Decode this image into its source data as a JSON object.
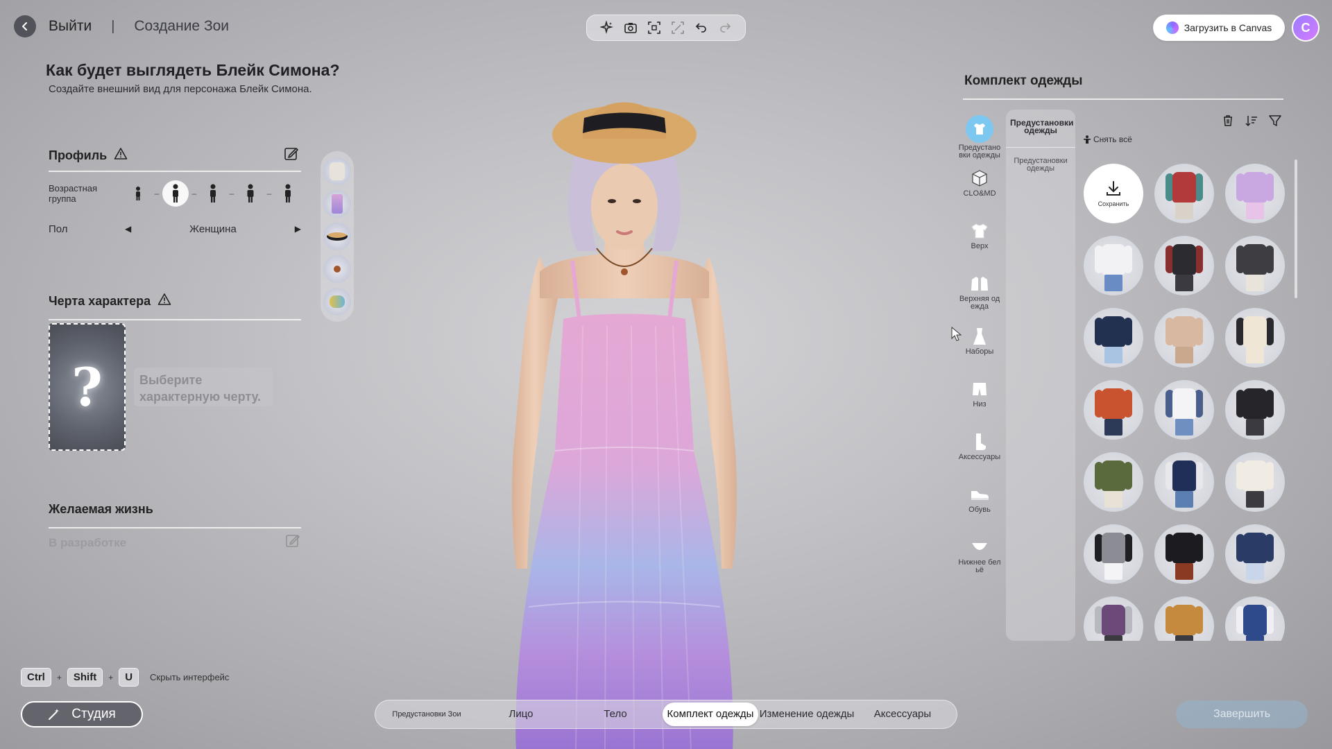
{
  "top": {
    "exit_label": "Выйти",
    "separator": "|",
    "breadcrumb": "Создание Зои",
    "tools": [
      "sparkle-icon",
      "camera-icon",
      "focus-frame-icon",
      "crop-frame-icon",
      "undo-icon",
      "redo-icon"
    ],
    "canvas_button": "Загрузить в Canvas",
    "avatar_letter": "C"
  },
  "left": {
    "headline": "Как будет выглядеть Блейк Симона?",
    "subline": "Создайте внешний вид для персонажа Блейк Симона.",
    "profile": {
      "title": "Профиль",
      "age_label": "Возрастная группа",
      "age_selected_index": 1,
      "gender_label": "Пол",
      "gender_value": "Женщина"
    },
    "trait": {
      "title": "Черта характера",
      "placeholder_glyph": "?",
      "hint": "Выберите характерную черту."
    },
    "life": {
      "title": "Желаемая жизнь",
      "status": "В разработке"
    },
    "shortcut": {
      "keys": [
        "Ctrl",
        "Shift",
        "U"
      ],
      "plus": "+",
      "label": "Скрыть интерфейс"
    },
    "studio_button": "Студия"
  },
  "tabs": [
    {
      "label": "Предустановки Зои",
      "active": false
    },
    {
      "label": "Лицо",
      "active": false
    },
    {
      "label": "Тело",
      "active": false
    },
    {
      "label": "Комплект одежды",
      "active": true
    },
    {
      "label": "Изменение одежды",
      "active": false
    },
    {
      "label": "Аксессуары",
      "active": false
    }
  ],
  "finish_button": "Завершить",
  "right": {
    "title": "Комплект одежды",
    "categories": [
      {
        "label": "Предустановки одежды",
        "icon": "outfit-preset-icon",
        "selected": true
      },
      {
        "label": "CLO&MD",
        "icon": "clo-cube-icon",
        "selected": false
      },
      {
        "label": "Верх",
        "icon": "tshirt-icon",
        "selected": false
      },
      {
        "label": "Верхняя одежда",
        "icon": "jacket-icon",
        "selected": false
      },
      {
        "label": "Наборы",
        "icon": "dress-icon",
        "selected": false
      },
      {
        "label": "Низ",
        "icon": "shorts-icon",
        "selected": false
      },
      {
        "label": "Аксессуары",
        "icon": "sock-icon",
        "selected": false
      },
      {
        "label": "Обувь",
        "icon": "shoe-icon",
        "selected": false
      },
      {
        "label": "Нижнее бельё",
        "icon": "underwear-icon",
        "selected": false
      }
    ],
    "subcategories": [
      {
        "label": "Предустановки одежды",
        "selected": true
      },
      {
        "label": "Предустановки одежды",
        "selected": false
      }
    ],
    "remove_all": "Снять всё",
    "save_label": "Сохранить",
    "grid_tools": [
      "trash-icon",
      "sort-icon",
      "filter-icon"
    ],
    "outfits": [
      {
        "top": "#b23a3a",
        "sleeves": "#4a8c8a",
        "bottom": "#d8d2c8"
      },
      {
        "top": "#c9a7e0",
        "sleeves": "#c9a7e0",
        "bottom": "#e7c3e8"
      },
      {
        "top": "#f2f2f4",
        "sleeves": "#f2f2f4",
        "bottom": "#6a8cc4"
      },
      {
        "top": "#2b2b30",
        "sleeves": "#8a2f2f",
        "bottom": "#3a3a40"
      },
      {
        "top": "#3e3e42",
        "sleeves": "#3e3e42",
        "bottom": "#e8e4dc"
      },
      {
        "top": "#22314f",
        "sleeves": "#22314f",
        "bottom": "#a9c4e2"
      },
      {
        "top": "#d8b8a0",
        "sleeves": "#d8b8a0",
        "bottom": "#caa88e"
      },
      {
        "top": "#efe6d6",
        "sleeves": "#2a2a2e",
        "bottom": "#efe6d6"
      },
      {
        "top": "#c8532e",
        "sleeves": "#c8532e",
        "bottom": "#2c3a58"
      },
      {
        "top": "#f4f4f6",
        "sleeves": "#4a5f8c",
        "bottom": "#6f8fc0"
      },
      {
        "top": "#26262a",
        "sleeves": "#26262a",
        "bottom": "#3a3a40"
      },
      {
        "top": "#5a6a3c",
        "sleeves": "#5a6a3c",
        "bottom": "#e8e2d6"
      },
      {
        "top": "#1f2f58",
        "sleeves": "#e8e8ec",
        "bottom": "#5a7fb0"
      },
      {
        "top": "#f0ece4",
        "sleeves": "#f0ece4",
        "bottom": "#3a3a40"
      },
      {
        "top": "#8c8c94",
        "sleeves": "#1f1f24",
        "bottom": "#f4f4f6"
      },
      {
        "top": "#1c1c20",
        "sleeves": "#1c1c20",
        "bottom": "#8a3a22"
      },
      {
        "top": "#2a3c66",
        "sleeves": "#2a3c66",
        "bottom": "#c9d6ea"
      },
      {
        "top": "#6b4a7a",
        "sleeves": "#b8b8c0",
        "bottom": "#3a3a40"
      },
      {
        "top": "#c58a3e",
        "sleeves": "#c58a3e",
        "bottom": "#3a3a40"
      },
      {
        "top": "#2e4a8a",
        "sleeves": "#f0f0f4",
        "bottom": "#2e4a8a"
      }
    ]
  },
  "colors": {
    "accent": "#7cc8f0",
    "dress_top": "#e5a8d4",
    "dress_mid": "#a9b6e8",
    "dress_bottom": "#9a74d2",
    "hat": "#d9a96a",
    "hat_band": "#1e1e22",
    "hair": "#c9bfd8",
    "skin": "#e9c6ad"
  }
}
